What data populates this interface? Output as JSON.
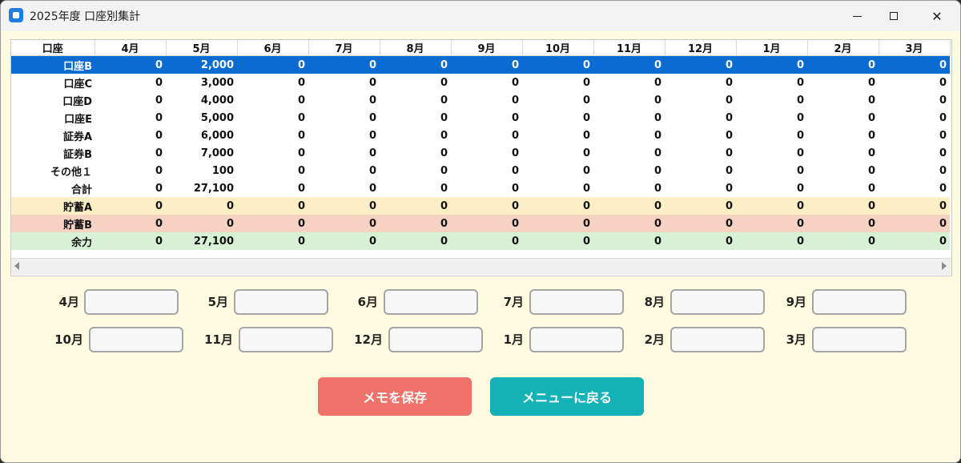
{
  "window": {
    "title": "2025年度 口座別集計"
  },
  "table": {
    "columns": [
      "口座",
      "4月",
      "5月",
      "6月",
      "7月",
      "8月",
      "9月",
      "10月",
      "11月",
      "12月",
      "1月",
      "2月",
      "3月"
    ],
    "rows": [
      {
        "account": "口座B",
        "values": [
          "0",
          "2,000",
          "0",
          "0",
          "0",
          "0",
          "0",
          "0",
          "0",
          "0",
          "0",
          "0"
        ],
        "style": "selected"
      },
      {
        "account": "口座C",
        "values": [
          "0",
          "3,000",
          "0",
          "0",
          "0",
          "0",
          "0",
          "0",
          "0",
          "0",
          "0",
          "0"
        ],
        "style": ""
      },
      {
        "account": "口座D",
        "values": [
          "0",
          "4,000",
          "0",
          "0",
          "0",
          "0",
          "0",
          "0",
          "0",
          "0",
          "0",
          "0"
        ],
        "style": ""
      },
      {
        "account": "口座E",
        "values": [
          "0",
          "5,000",
          "0",
          "0",
          "0",
          "0",
          "0",
          "0",
          "0",
          "0",
          "0",
          "0"
        ],
        "style": ""
      },
      {
        "account": "証券A",
        "values": [
          "0",
          "6,000",
          "0",
          "0",
          "0",
          "0",
          "0",
          "0",
          "0",
          "0",
          "0",
          "0"
        ],
        "style": ""
      },
      {
        "account": "証券B",
        "values": [
          "0",
          "7,000",
          "0",
          "0",
          "0",
          "0",
          "0",
          "0",
          "0",
          "0",
          "0",
          "0"
        ],
        "style": ""
      },
      {
        "account": "その他１",
        "values": [
          "0",
          "100",
          "0",
          "0",
          "0",
          "0",
          "0",
          "0",
          "0",
          "0",
          "0",
          "0"
        ],
        "style": ""
      },
      {
        "account": "合計",
        "values": [
          "0",
          "27,100",
          "0",
          "0",
          "0",
          "0",
          "0",
          "0",
          "0",
          "0",
          "0",
          "0"
        ],
        "style": ""
      },
      {
        "account": "貯蓄A",
        "values": [
          "0",
          "0",
          "0",
          "0",
          "0",
          "0",
          "0",
          "0",
          "0",
          "0",
          "0",
          "0"
        ],
        "style": "tint-yellow"
      },
      {
        "account": "貯蓄B",
        "values": [
          "0",
          "0",
          "0",
          "0",
          "0",
          "0",
          "0",
          "0",
          "0",
          "0",
          "0",
          "0"
        ],
        "style": "tint-red"
      },
      {
        "account": "余力",
        "values": [
          "0",
          "27,100",
          "0",
          "0",
          "0",
          "0",
          "0",
          "0",
          "0",
          "0",
          "0",
          "0"
        ],
        "style": "tint-green"
      }
    ]
  },
  "memo": {
    "row1": [
      {
        "label": "4月",
        "value": ""
      },
      {
        "label": "5月",
        "value": ""
      },
      {
        "label": "6月",
        "value": ""
      },
      {
        "label": "7月",
        "value": ""
      },
      {
        "label": "8月",
        "value": ""
      },
      {
        "label": "9月",
        "value": ""
      }
    ],
    "row2": [
      {
        "label": "10月",
        "value": ""
      },
      {
        "label": "11月",
        "value": ""
      },
      {
        "label": "12月",
        "value": ""
      },
      {
        "label": "1月",
        "value": ""
      },
      {
        "label": "2月",
        "value": ""
      },
      {
        "label": "3月",
        "value": ""
      }
    ]
  },
  "buttons": {
    "save": "メモを保存",
    "back": "メニューに戻る"
  },
  "colors": {
    "selected_row": "#0a6bd1",
    "savings_a_row": "#fcefc5",
    "savings_b_row": "#f6d2c3",
    "remaining_row": "#d8f1d6",
    "save_button": "#ef726a",
    "back_button": "#14b1b7",
    "background": "#fffbe0"
  }
}
